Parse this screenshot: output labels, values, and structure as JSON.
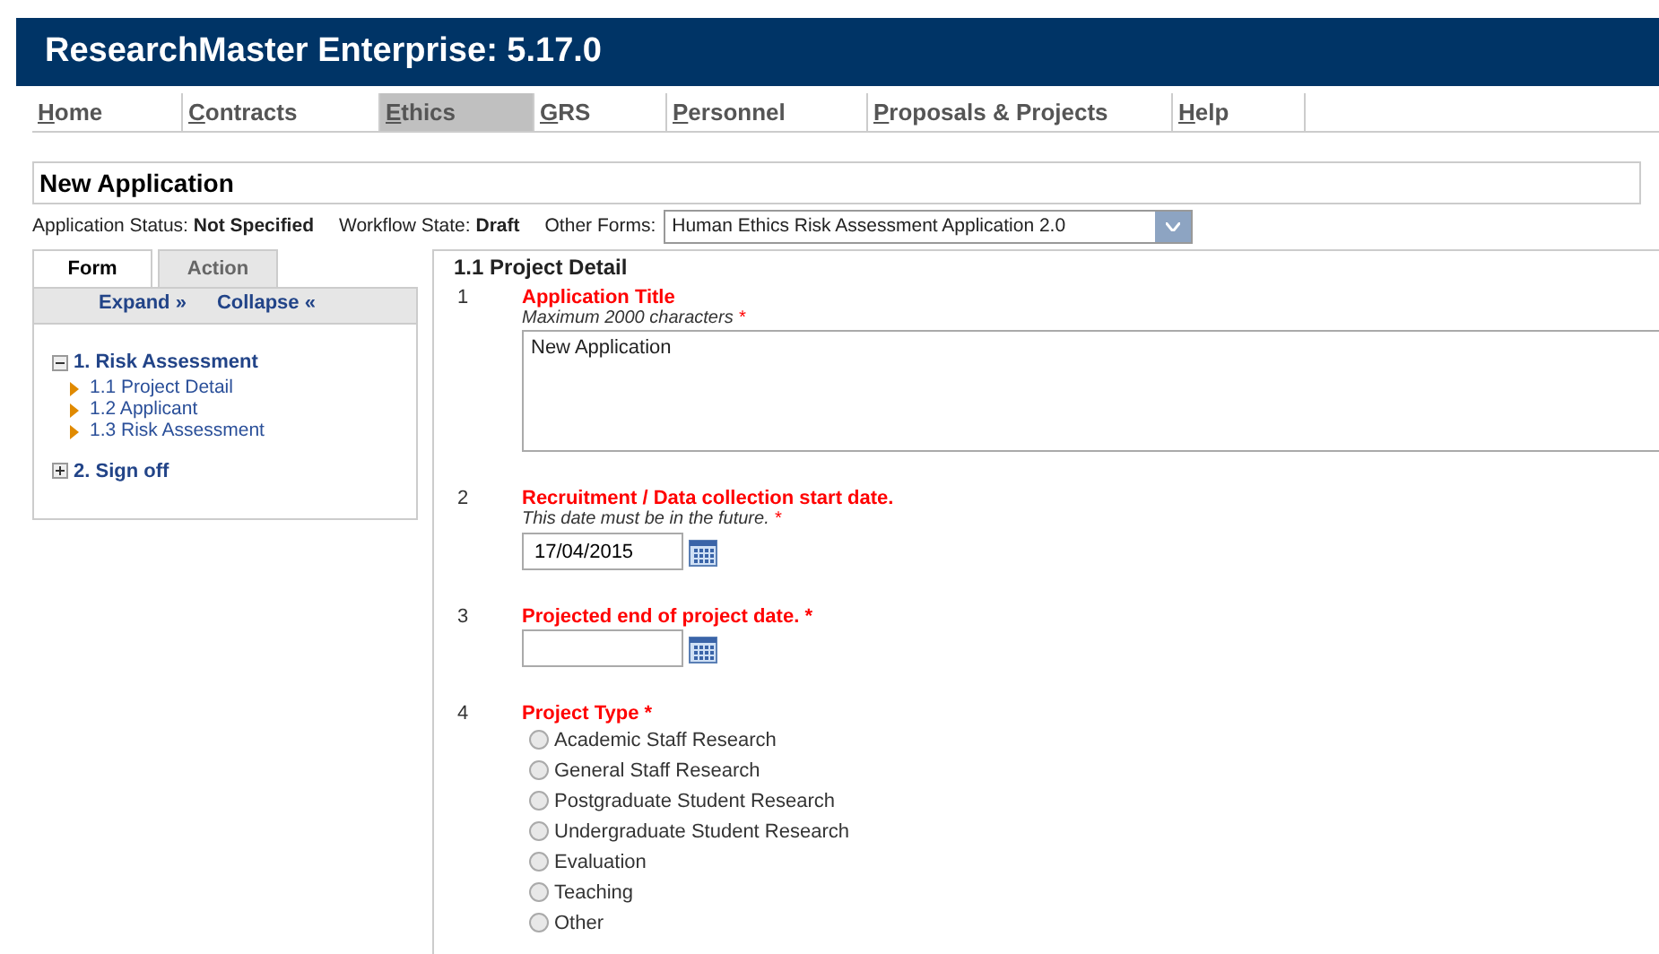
{
  "app_title": "ResearchMaster Enterprise: 5.17.0",
  "nav": [
    {
      "label": "Home",
      "selected": false
    },
    {
      "label": "Contracts",
      "selected": false
    },
    {
      "label": "Ethics",
      "selected": true
    },
    {
      "label": "GRS",
      "selected": false
    },
    {
      "label": "Personnel",
      "selected": false
    },
    {
      "label": "Proposals & Projects",
      "selected": false
    },
    {
      "label": "Help",
      "selected": false
    }
  ],
  "page_title": "New Application",
  "status": [
    {
      "label": "Application Status:",
      "value": "Not Specified"
    },
    {
      "label": "Workflow State:",
      "value": "Draft"
    }
  ],
  "other_forms": {
    "label": "Other Forms:",
    "value": "Human Ethics Risk Assessment Application 2.0"
  },
  "side_tabs": [
    {
      "label": "Form",
      "selected": true
    },
    {
      "label": "Action",
      "selected": false
    }
  ],
  "side_links": [
    "Expand »",
    "Collapse «"
  ],
  "tree": [
    {
      "label": "1. Risk Assessment",
      "expanded": true,
      "children": [
        {
          "label": "1.1 Project Detail"
        },
        {
          "label": "1.2 Applicant"
        },
        {
          "label": "1.3 Risk Assessment"
        }
      ]
    },
    {
      "label": "2. Sign off",
      "expanded": false
    }
  ],
  "section_title": "1.1 Project Detail",
  "questions": [
    {
      "number": "1",
      "kind": "textarea",
      "label": "Application Title",
      "hint": "Maximum 2000 characters",
      "mark": "*",
      "value": "New Application"
    },
    {
      "number": "2",
      "kind": "date",
      "label": "Recruitment / Data collection start date.",
      "hint": "This date must be in the future.",
      "mark": "*",
      "value": "17/04/2015"
    },
    {
      "number": "3",
      "kind": "date",
      "label": "Projected end of project date.",
      "mark": "*"
    },
    {
      "number": "4",
      "kind": "radio",
      "label": "Project Type",
      "mark": "*",
      "options": [
        {
          "label": "Academic Staff Research",
          "selected": false
        },
        {
          "label": "General Staff Research",
          "selected": false
        },
        {
          "label": "Postgraduate Student Research",
          "selected": false
        },
        {
          "label": "Undergraduate Student Research",
          "selected": false
        },
        {
          "label": "Evaluation",
          "selected": false
        },
        {
          "label": "Teaching",
          "selected": false
        },
        {
          "label": "Other",
          "selected": false
        }
      ]
    }
  ]
}
